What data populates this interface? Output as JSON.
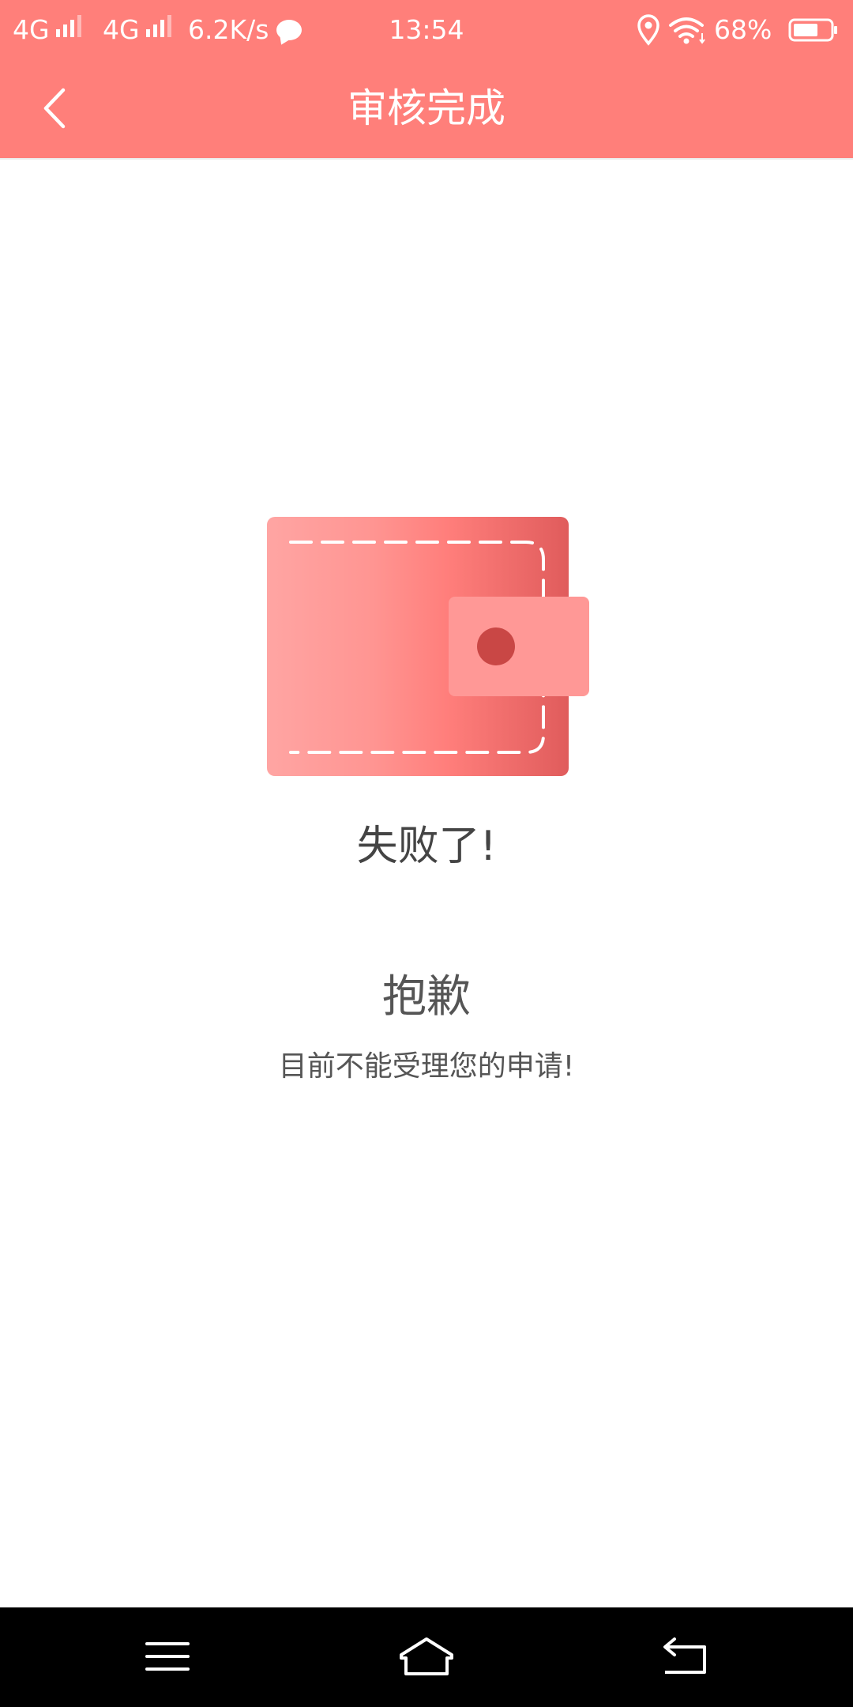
{
  "status_bar": {
    "network_1": "4G",
    "network_2": "4G",
    "speed": "6.2K/s",
    "time": "13:54",
    "battery": "68%",
    "battery_level": 0.68,
    "icons": [
      "signal-icon",
      "chat-bubble-icon",
      "location-icon",
      "wifi-icon",
      "battery-icon"
    ]
  },
  "header": {
    "title": "审核完成",
    "back_icon": "chevron-left-icon"
  },
  "result": {
    "illustration": "wallet-illustration",
    "status_text": "失败了!",
    "title": "抱歉",
    "message": "目前不能受理您的申请!"
  },
  "nav_bar": {
    "items": [
      "menu-icon",
      "home-icon",
      "back-icon"
    ]
  },
  "colors": {
    "brand": "#ff7f7a",
    "wallet_dark": "#e25d5d",
    "wallet_light": "#ffa5a3",
    "clasp": "#ff9896",
    "button_dot": "#c94745",
    "text_primary": "#444444",
    "text_secondary": "#555555"
  }
}
